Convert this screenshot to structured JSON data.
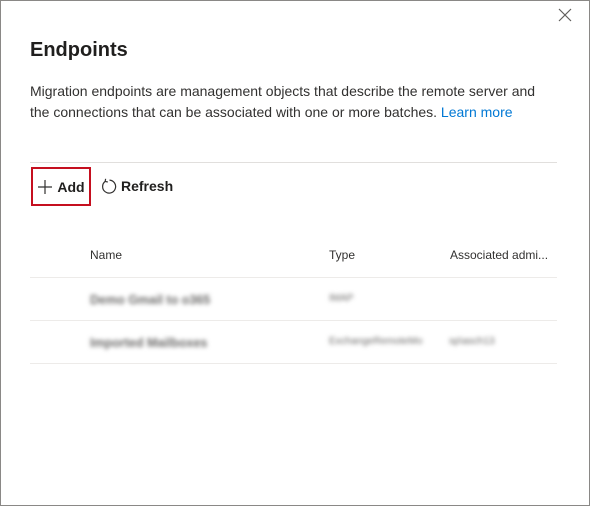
{
  "panel": {
    "title": "Endpoints",
    "description": "Migration endpoints are management objects that describe the remote server and the connections that can be associated with one or more batches.",
    "learn_more": "Learn more"
  },
  "toolbar": {
    "add_label": "Add",
    "refresh_label": "Refresh"
  },
  "table": {
    "columns": [
      "Name",
      "Type",
      "Associated admi..."
    ],
    "rows": [
      {
        "name": "Demo Gmail to o365",
        "type": "IMAP",
        "admin": ""
      },
      {
        "name": "Imported Mailboxes",
        "type": "ExchangeRemoteMo",
        "admin": "sp\\asch13"
      }
    ]
  },
  "icons": {
    "close": "close-icon",
    "add": "plus-icon",
    "refresh": "refresh-icon"
  },
  "colors": {
    "link": "#0078d4",
    "highlight_border": "#c50f1f"
  }
}
